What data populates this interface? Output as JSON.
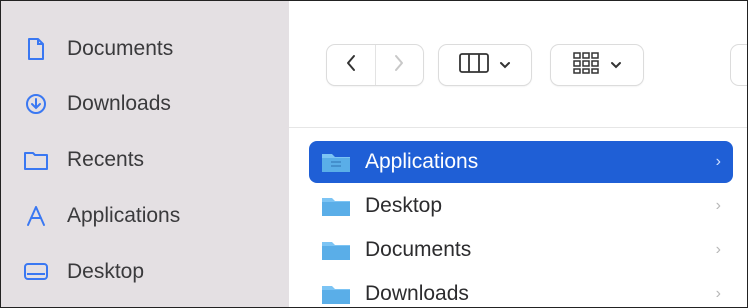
{
  "sidebar": {
    "items": [
      {
        "label": "Documents",
        "icon": "document-icon"
      },
      {
        "label": "Downloads",
        "icon": "download-icon"
      },
      {
        "label": "Recents",
        "icon": "recents-folder-icon"
      },
      {
        "label": "Applications",
        "icon": "applications-icon"
      },
      {
        "label": "Desktop",
        "icon": "desktop-icon"
      }
    ],
    "accent": "#3a78f2"
  },
  "toolbar": {
    "back_icon": "chevron-left-icon",
    "forward_icon": "chevron-right-icon",
    "column_view_icon": "column-view-icon",
    "grid_view_icon": "grid-view-icon"
  },
  "list": {
    "items": [
      {
        "label": "Applications",
        "selected": true
      },
      {
        "label": "Desktop",
        "selected": false
      },
      {
        "label": "Documents",
        "selected": false
      },
      {
        "label": "Downloads",
        "selected": false
      }
    ],
    "selection_color": "#1f5fd6",
    "folder_color": "#5aaee8"
  }
}
